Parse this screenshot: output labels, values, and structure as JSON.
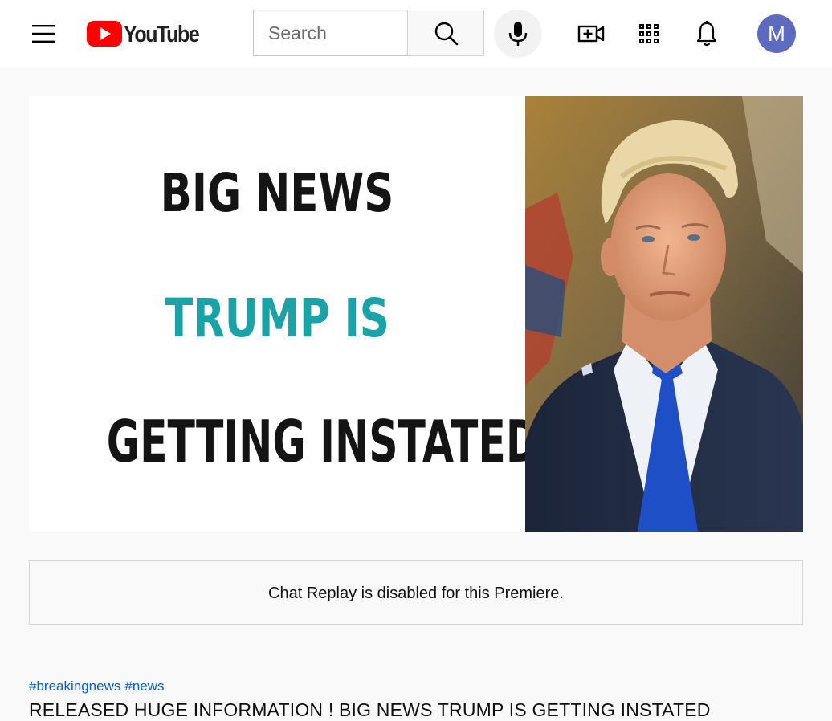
{
  "masthead": {
    "logo_text": "YouTube",
    "search_placeholder": "Search",
    "avatar_letter": "M",
    "colors": {
      "brand_red": "#ff0000",
      "avatar_bg": "#5c6bc0"
    },
    "icons": [
      "menu-icon",
      "youtube-play-icon",
      "search-icon",
      "microphone-icon",
      "create-video-icon",
      "apps-grid-icon",
      "notifications-bell-icon"
    ]
  },
  "thumbnail": {
    "line1": "BIG NEWS",
    "line2": "TRUMP IS",
    "line3": "GETTING INSTATED",
    "colors": {
      "line2": "#1aa3a7",
      "text": "#141414"
    }
  },
  "chat": {
    "message": "Chat Replay is disabled for this Premiere."
  },
  "video": {
    "hashtags": [
      "#breakingnews",
      "#news"
    ],
    "title": "RELEASED HUGE INFORMATION ! BIG NEWS TRUMP IS GETTING INSTATED"
  }
}
